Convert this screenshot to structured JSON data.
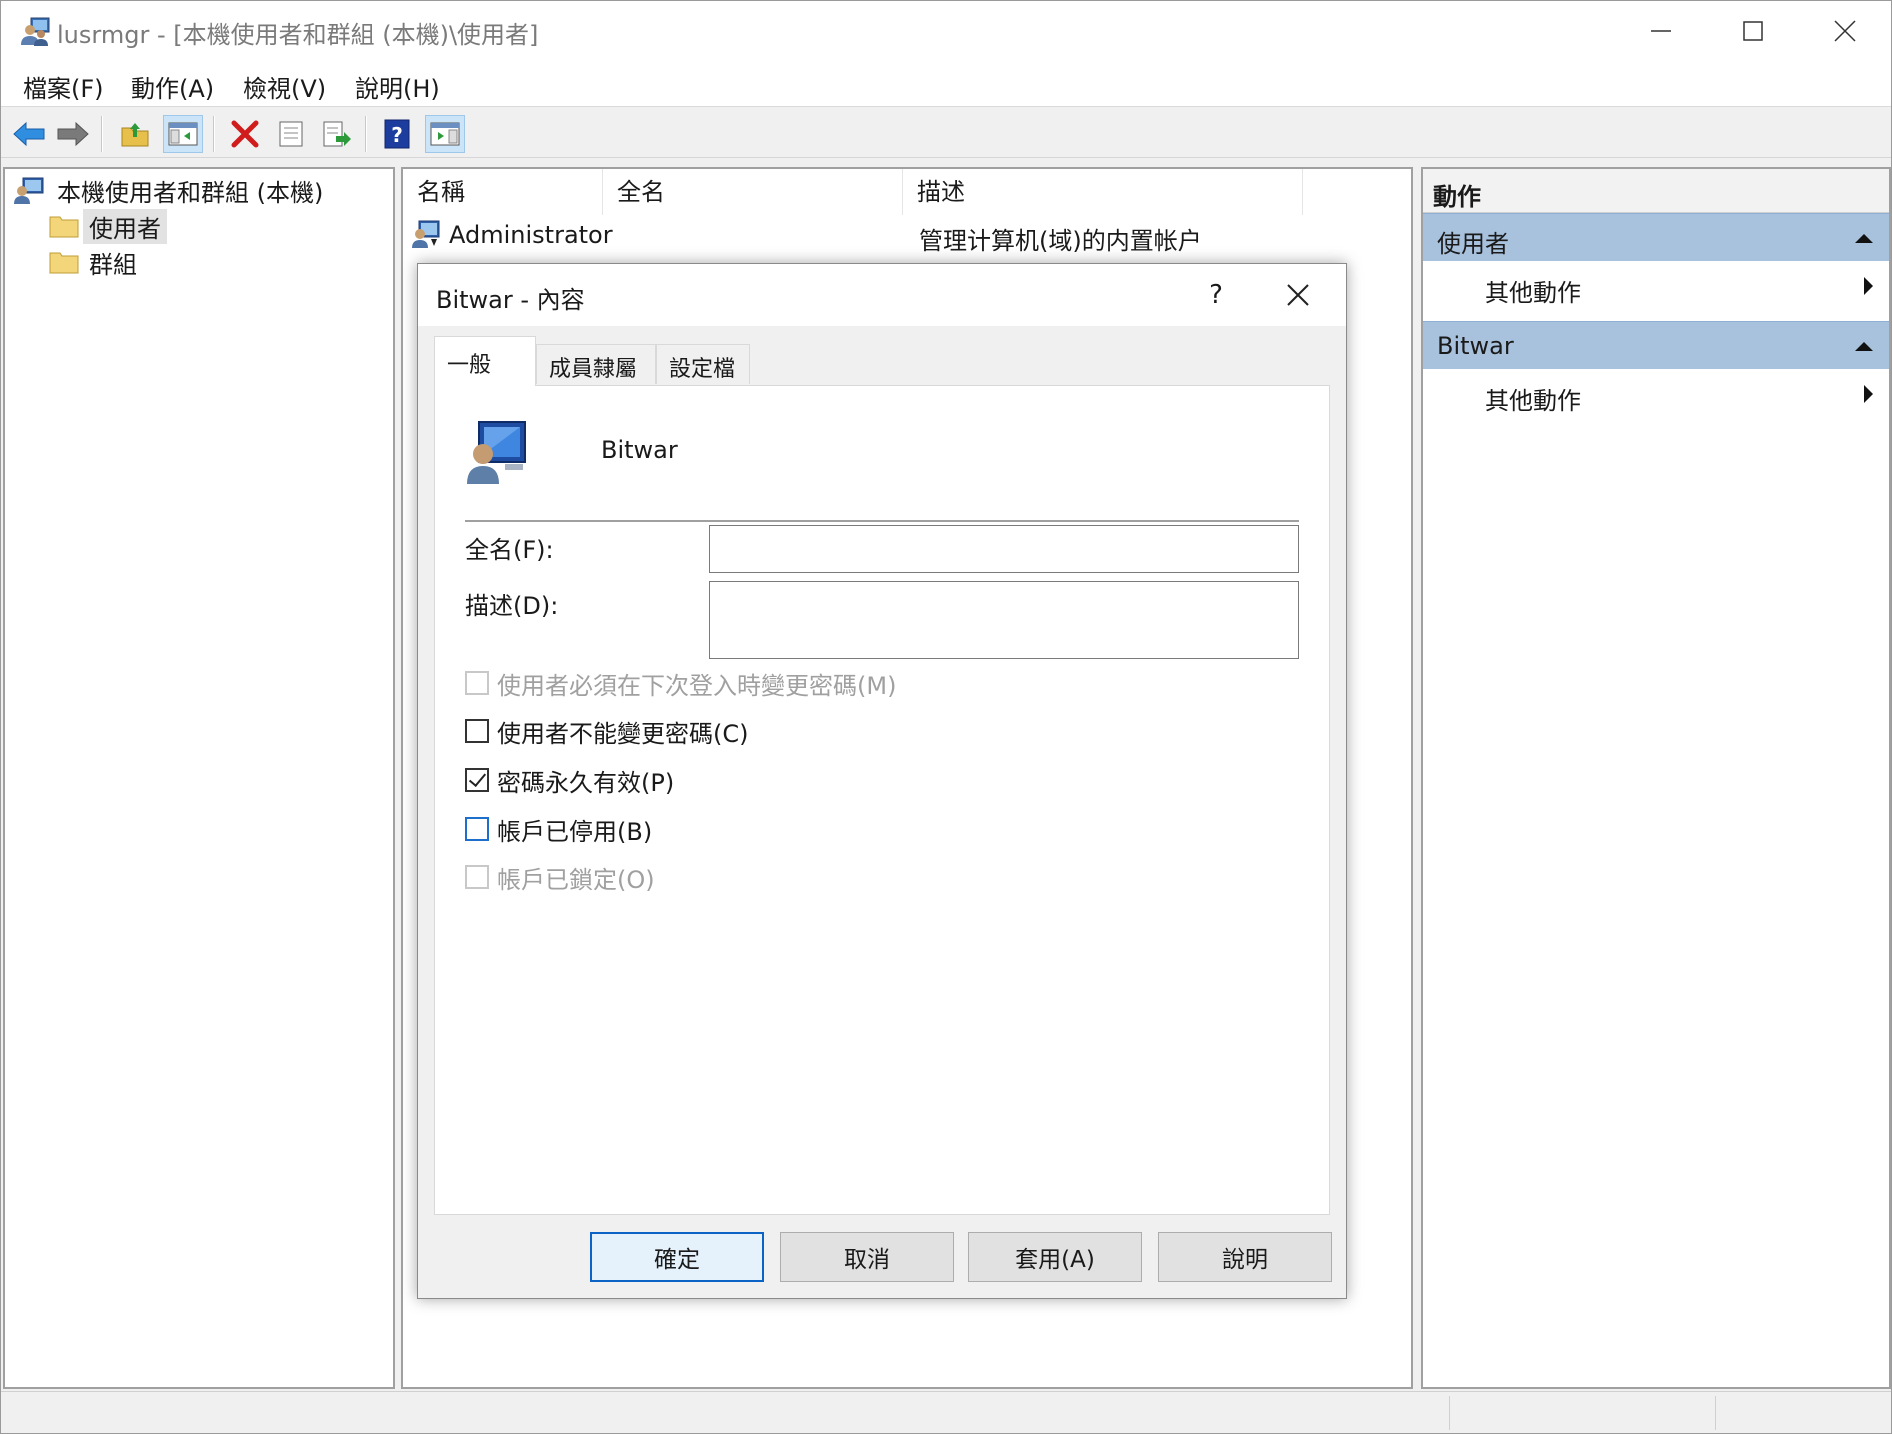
{
  "window": {
    "title": "lusrmgr - [本機使用者和群組 (本機)\\使用者]"
  },
  "menu": [
    "檔案(F)",
    "動作(A)",
    "檢視(V)",
    "說明(H)"
  ],
  "toolbar": {
    "icons": [
      "back-arrow-icon",
      "forward-arrow-icon",
      "up-folder-icon",
      "show-hide-tree-icon",
      "delete-icon",
      "properties-icon",
      "export-list-icon",
      "help-icon",
      "show-hide-action-pane-icon"
    ]
  },
  "tree": {
    "root": "本機使用者和群組 (本機)",
    "items": [
      "使用者",
      "群組"
    ]
  },
  "list": {
    "columns": [
      "名稱",
      "全名",
      "描述"
    ],
    "rows": [
      {
        "name": "Administrator",
        "fullname": "",
        "description": "管理计算机(域)的内置帐户"
      }
    ]
  },
  "actions": {
    "title": "動作",
    "sections": [
      {
        "label": "使用者",
        "item": "其他動作"
      },
      {
        "label": "Bitwar",
        "item": "其他動作"
      }
    ]
  },
  "dialog": {
    "title": "Bitwar - 內容",
    "help_glyph": "?",
    "tabs": [
      "一般",
      "成員隸屬",
      "設定檔"
    ],
    "user_name": "Bitwar",
    "fullname_label": "全名(F):",
    "fullname_value": "",
    "description_label": "描述(D):",
    "description_value": "",
    "checkboxes": [
      {
        "label": "使用者必須在下次登入時變更密碼(M)",
        "checked": false,
        "disabled": true
      },
      {
        "label": "使用者不能變更密碼(C)",
        "checked": false,
        "disabled": false
      },
      {
        "label": "密碼永久有效(P)",
        "checked": true,
        "disabled": false
      },
      {
        "label": "帳戶已停用(B)",
        "checked": false,
        "disabled": false
      },
      {
        "label": "帳戶已鎖定(O)",
        "checked": false,
        "disabled": true
      }
    ],
    "buttons": [
      "確定",
      "取消",
      "套用(A)",
      "說明"
    ]
  }
}
